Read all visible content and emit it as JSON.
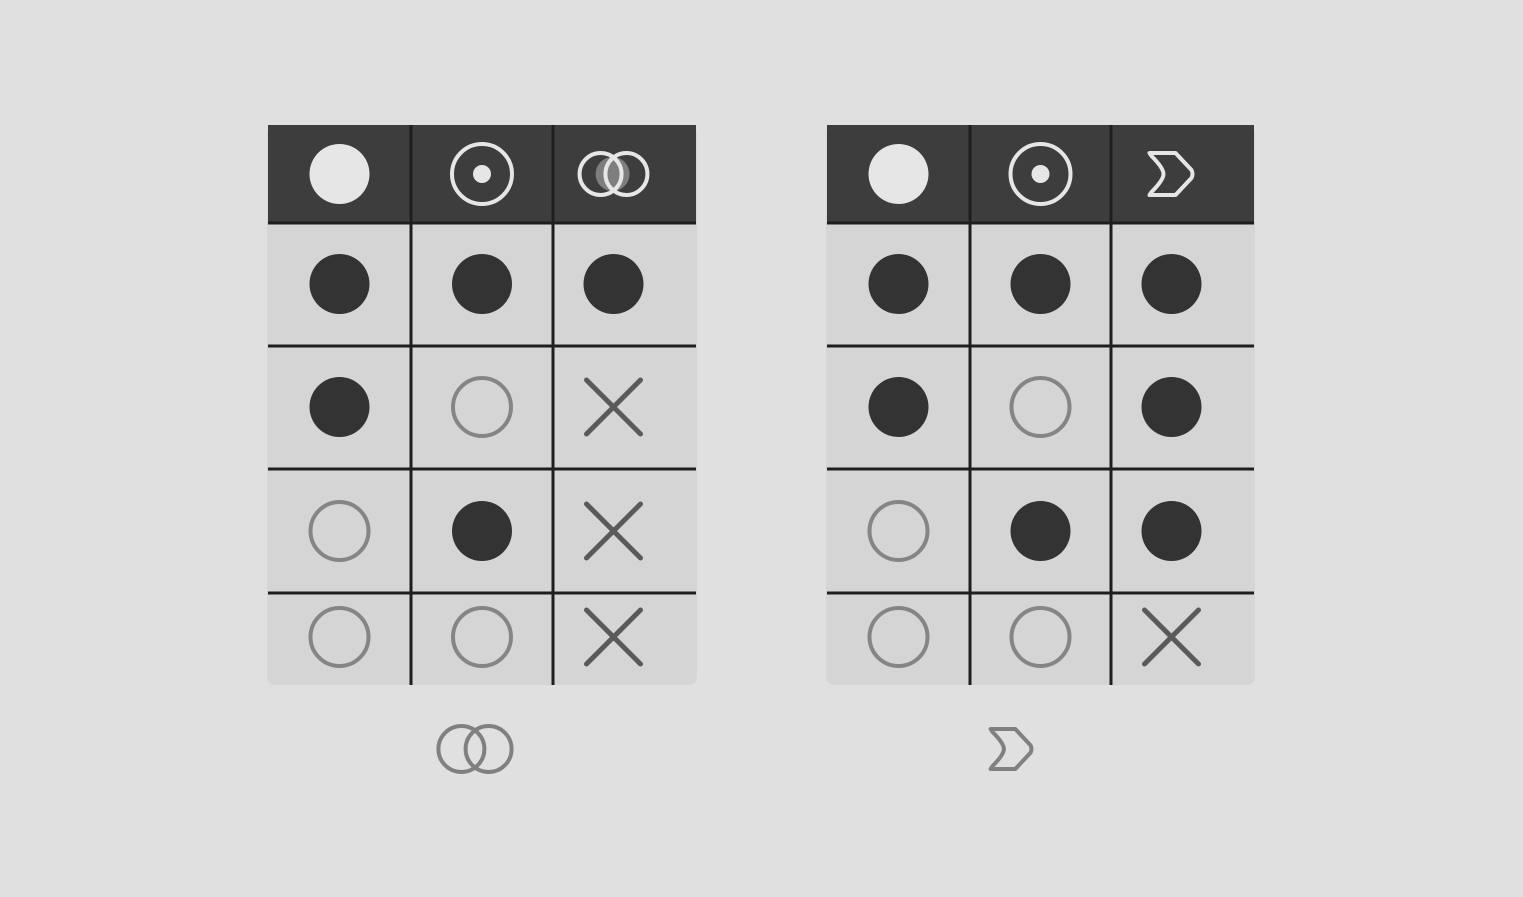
{
  "colors": {
    "background": "#e0e0e0",
    "header_fill": "#3d3d3d",
    "body_fill": "#d5d5d5",
    "grid_line": "#1e1e1e",
    "header_icon": "#e6e6e6",
    "filled_mark": "#333333",
    "hollow_mark": "#858585",
    "cross_mark": "#5a5a5a",
    "caption_icon": "#808080"
  },
  "tables": [
    {
      "name": "intersection",
      "header_icons": [
        "filled-circle-icon",
        "circled-dot-icon",
        "overlapping-circles-icon"
      ],
      "rows": [
        [
          "filled",
          "filled",
          "filled"
        ],
        [
          "filled",
          "hollow",
          "cross"
        ],
        [
          "hollow",
          "filled",
          "cross"
        ],
        [
          "hollow",
          "hollow",
          "cross"
        ]
      ],
      "caption_icon": "overlapping-circles-icon"
    },
    {
      "name": "chevron",
      "header_icons": [
        "filled-circle-icon",
        "circled-dot-icon",
        "chevron-arrow-icon"
      ],
      "rows": [
        [
          "filled",
          "filled",
          "filled"
        ],
        [
          "filled",
          "hollow",
          "filled"
        ],
        [
          "hollow",
          "filled",
          "filled"
        ],
        [
          "hollow",
          "hollow",
          "cross"
        ]
      ],
      "caption_icon": "chevron-arrow-icon"
    }
  ]
}
